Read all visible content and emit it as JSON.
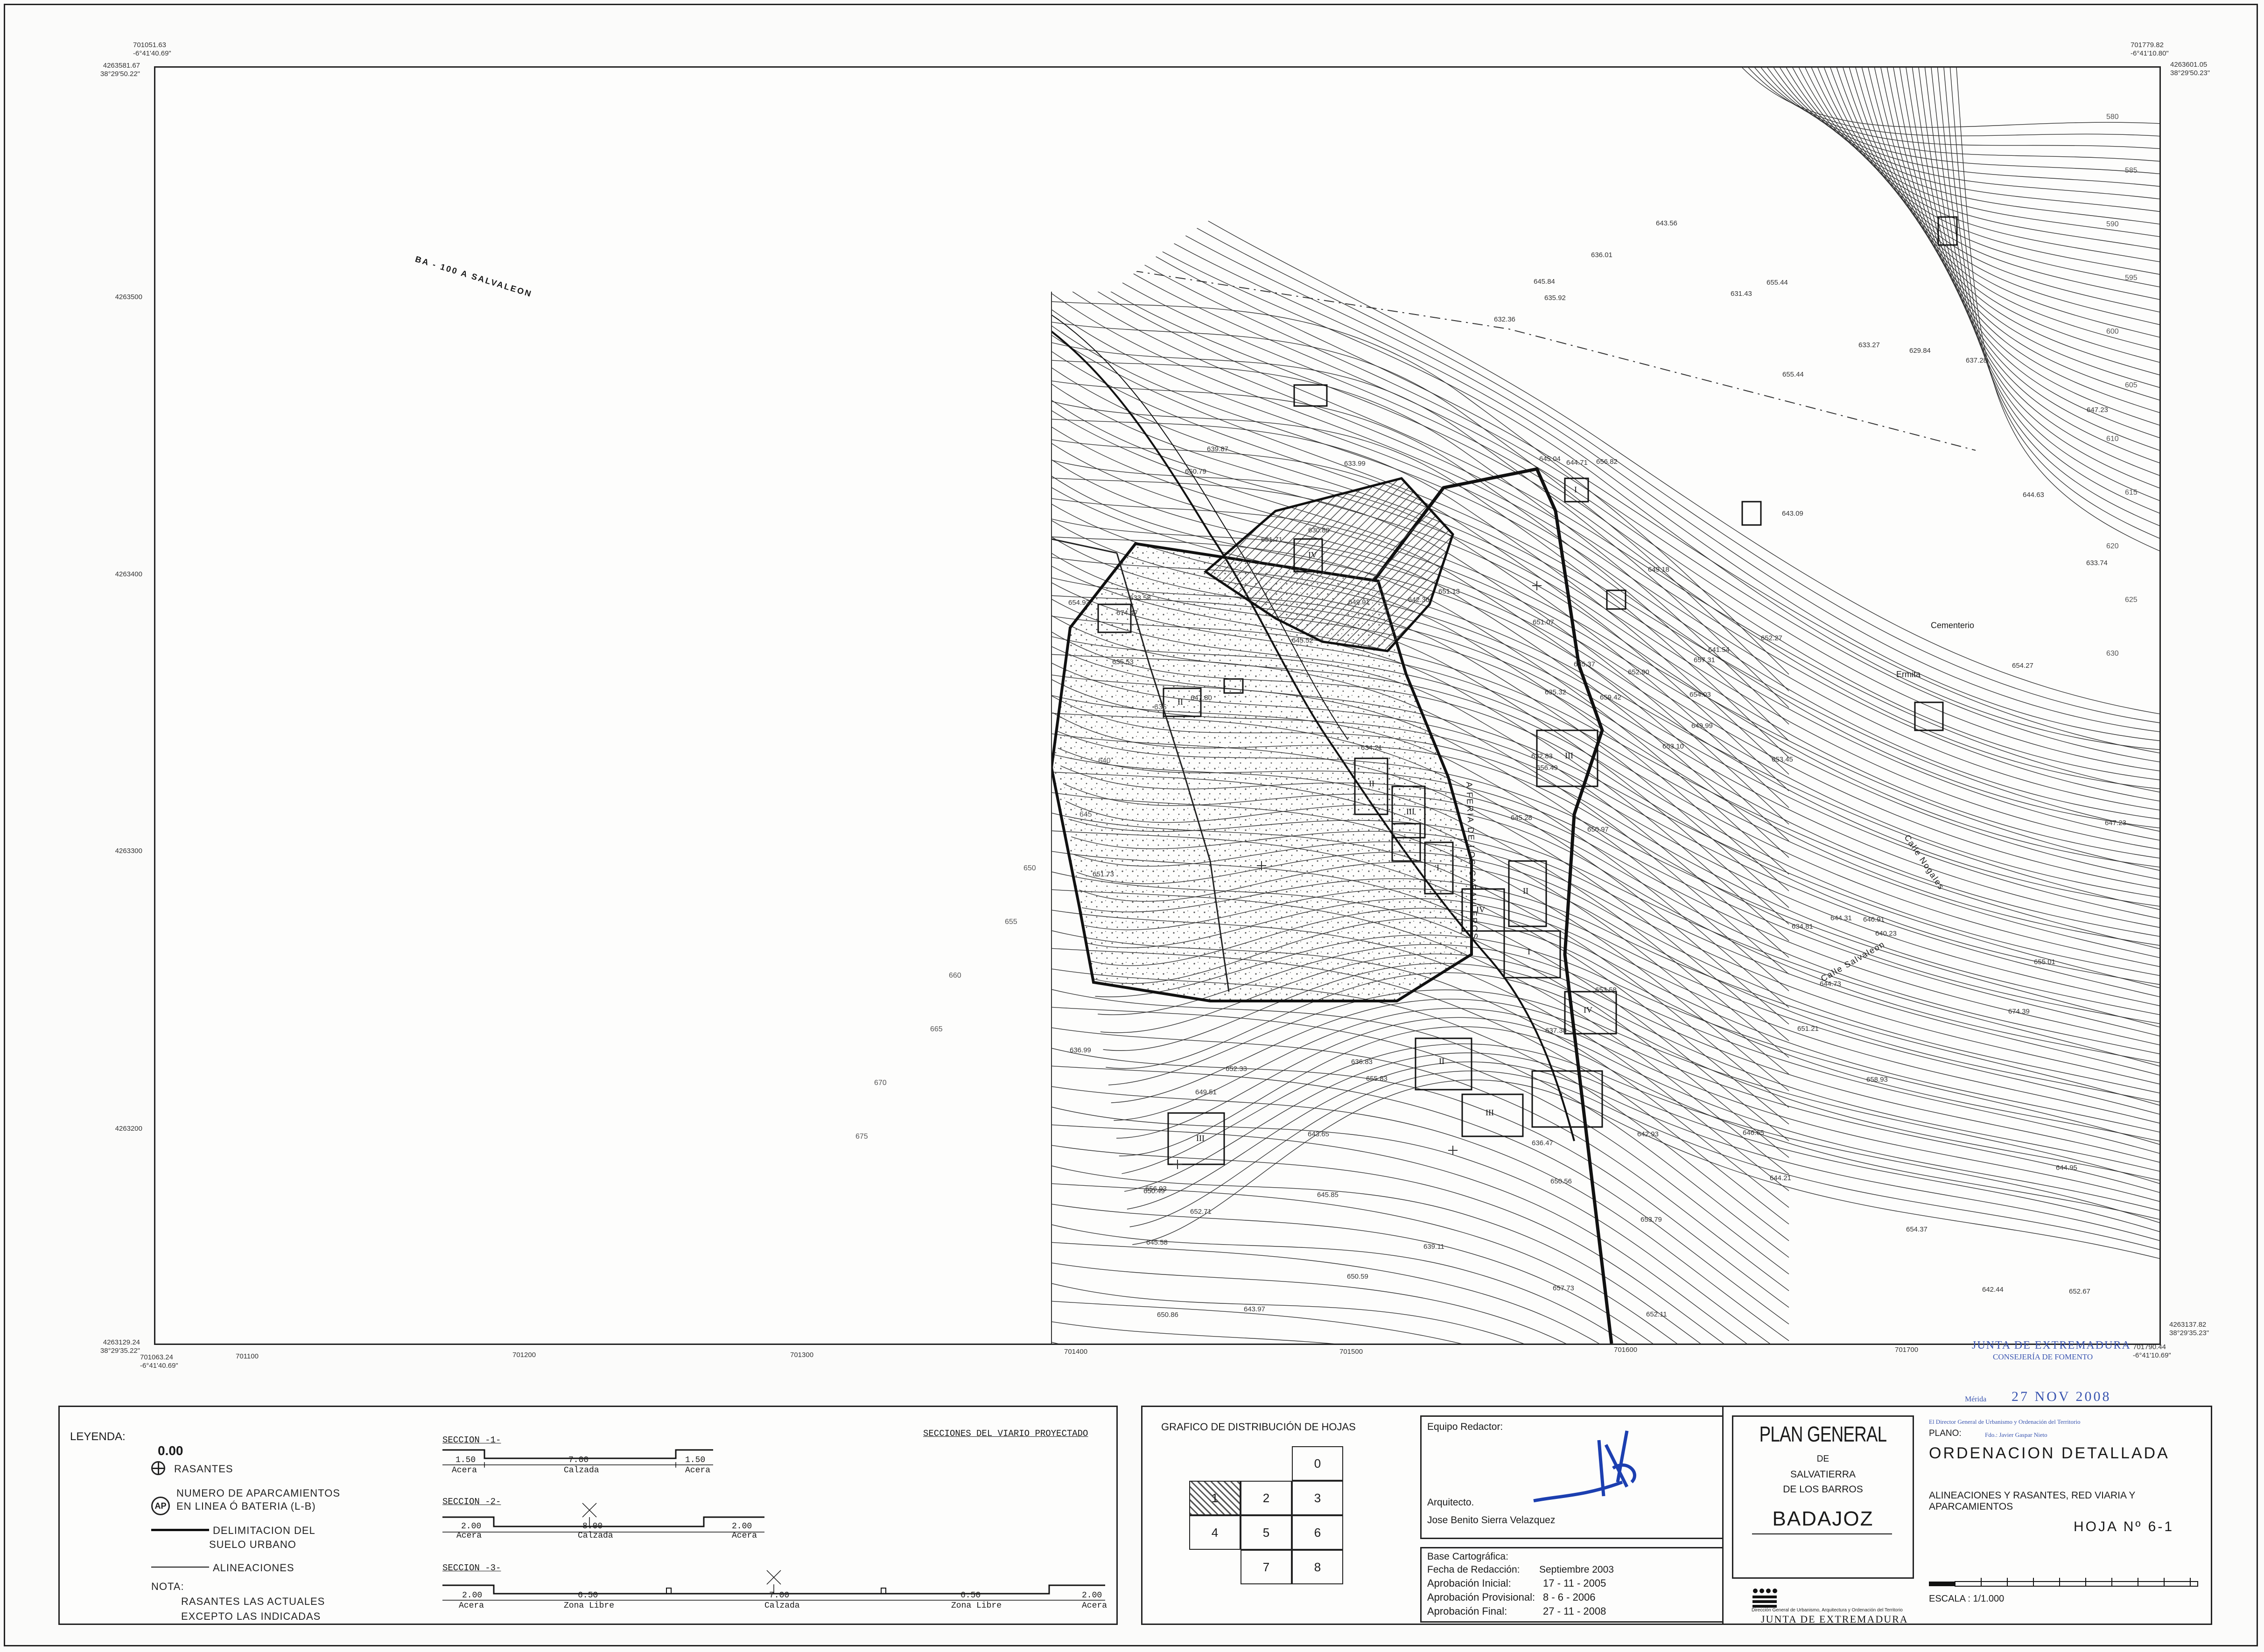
{
  "sheet_corners": {
    "tl_top": "701051.63\n-6°41'40.69\"",
    "tl_left": "4263581.67\n38°29'50.22\"",
    "tr_top": "701779.82\n-6°41'10.80\"",
    "tr_right": "4263601.05\n38°29'50.23\"",
    "bl_left": "4263129.24\n38°29'35.22\"",
    "bl_bottom": "701063.24\n-6°41'40.69\"",
    "br_right": "4263137.82\n38°29'35.23\"",
    "br_bottom": "701790.44\n-6°41'10.69\""
  },
  "northings": [
    "4263500",
    "4263400",
    "4263300",
    "4263200"
  ],
  "eastings": [
    "701100",
    "701200",
    "701300",
    "701400",
    "701500",
    "701600",
    "701700"
  ],
  "map": {
    "road_labels": [
      "BA - 100 A SALVALEON",
      "A FERIA DE LOS CABALLEROS",
      "Calle Salvaleon",
      "Calle Nogales"
    ],
    "cemetery_label": "Cementerio",
    "cemetery_label_2": "Ermita",
    "contour_labels": [
      "580",
      "585",
      "590",
      "595",
      "600",
      "605",
      "610",
      "615",
      "620",
      "625",
      "630",
      "635",
      "640",
      "645",
      "650",
      "655",
      "660",
      "665",
      "670",
      "675"
    ],
    "spot_heights": [
      "650.97",
      "650.79",
      "656.49",
      "656.93",
      "657.31",
      "655.83",
      "655.44",
      "656.82",
      "655.44",
      "653.10",
      "652.67",
      "647.80",
      "647.23",
      "645.28",
      "643.09",
      "643.97",
      "645.04",
      "649.18",
      "652.33",
      "651.13",
      "645.58",
      "645.85",
      "644.71",
      "641.54",
      "640.23",
      "639.87",
      "635.92",
      "635.53",
      "634.81",
      "633.74",
      "632.83",
      "636.47",
      "635.32",
      "633.99",
      "633.27",
      "636.83",
      "642.44",
      "644.95",
      "646.91",
      "643.56",
      "642.36",
      "645.52",
      "651.21",
      "650.59",
      "654.93",
      "654.03",
      "650.86",
      "650.56",
      "649.99",
      "649.51",
      "644.63",
      "644.73",
      "644.21",
      "643.65",
      "642.93",
      "637.28",
      "636.01",
      "634.21",
      "633.58",
      "630.80",
      "629.84",
      "631.43",
      "632.36",
      "635.37",
      "636.99",
      "637.38",
      "639.11",
      "644.31",
      "649.91",
      "650.49",
      "651.71",
      "651.73",
      "651.07",
      "653.79",
      "652.90",
      "652.71",
      "653.45",
      "655.01",
      "657.73",
      "654.27",
      "653.58",
      "654.37",
      "652.11",
      "646.65",
      "645.84",
      "647.23",
      "652.27",
      "658.93",
      "659.42",
      "674.39",
      "674.47"
    ],
    "block_marks": [
      "II",
      "III",
      "I",
      "IV"
    ]
  },
  "legend": {
    "title": "LEYENDA:",
    "rasantes_value": "0.00",
    "rasantes_label": "RASANTES",
    "ap_symbol": "AP",
    "ap_label_1": "NUMERO DE APARCAMIENTOS",
    "ap_label_2": "EN LINEA Ó BATERIA (L-B)",
    "delim_label_1": "DELIMITACION DEL",
    "delim_label_2": "SUELO URBANO",
    "alineaciones_label": "ALINEACIONES",
    "nota_title": "NOTA:",
    "nota_1": "RASANTES LAS ACTUALES",
    "nota_2": "EXCEPTO LAS INDICADAS"
  },
  "sections": {
    "heading": "SECCIONES DEL VIARIO PROYECTADO",
    "s1": {
      "title": "SECCION -1-",
      "dims": [
        "1.50",
        "7.00",
        "1.50"
      ],
      "names": [
        "Acera",
        "Calzada",
        "Acera"
      ]
    },
    "s2": {
      "title": "SECCION -2-",
      "dims": [
        "2.00",
        "8.00",
        "2.00"
      ],
      "names": [
        "Acera",
        "Calzada",
        "Acera"
      ]
    },
    "s3": {
      "title": "SECCION -3-",
      "dims": [
        "2.00",
        "6.50",
        "7.00",
        "6.50",
        "2.00"
      ],
      "names": [
        "Acera",
        "Zona Libre",
        "Calzada",
        "Zona Libre",
        "Acera"
      ]
    }
  },
  "distribution": {
    "title": "GRAFICO DE DISTRIBUCIÓN DE HOJAS",
    "cells": [
      "0",
      "1",
      "2",
      "3",
      "4",
      "5",
      "6",
      "7",
      "8"
    ]
  },
  "team": {
    "title": "Equipo Redactor:",
    "role": "Arquitecto.",
    "name": "Jose Benito Sierra Velazquez",
    "base": "Base Cartográfica:",
    "fecha_label": "Fecha de Redacción:",
    "fecha_value": "Septiembre 2003",
    "inicial_label": "Aprobación Inicial:",
    "inicial_value": "17 - 11 - 2005",
    "provisional_label": "Aprobación Provisional:",
    "provisional_value": "8 - 6 - 2006",
    "final_label": "Aprobación Final:",
    "final_value": "27 - 11 - 2008"
  },
  "title_block": {
    "plan": "PLAN GENERAL",
    "de": "DE",
    "town_1": "SALVATIERRA",
    "town_2": "DE LOS BARROS",
    "province": "BADAJOZ",
    "plano_label": "PLANO:",
    "plano_title": "ORDENACION DETALLADA",
    "plano_subtitle": "ALINEACIONES Y RASANTES, RED VIARIA Y APARCAMIENTOS",
    "hoja": "HOJA Nº 6-1",
    "escala": "ESCALA : 1/1.000",
    "junta_small": "Dirección General de Urbanismo, Arquitectura y Ordenación del Territorio",
    "junta": "JUNTA DE EXTREMADURA"
  },
  "stamp": {
    "line1": "JUNTA DE EXTREMADURA",
    "line2": "CONSEJERÍA DE FOMENTO",
    "date_city": "Mérida",
    "date": "27 NOV 2008",
    "director": "El Director General de Urbanismo y Ordenación del Territorio",
    "signer": "Fdo.: Javier Gaspar Nieto"
  }
}
